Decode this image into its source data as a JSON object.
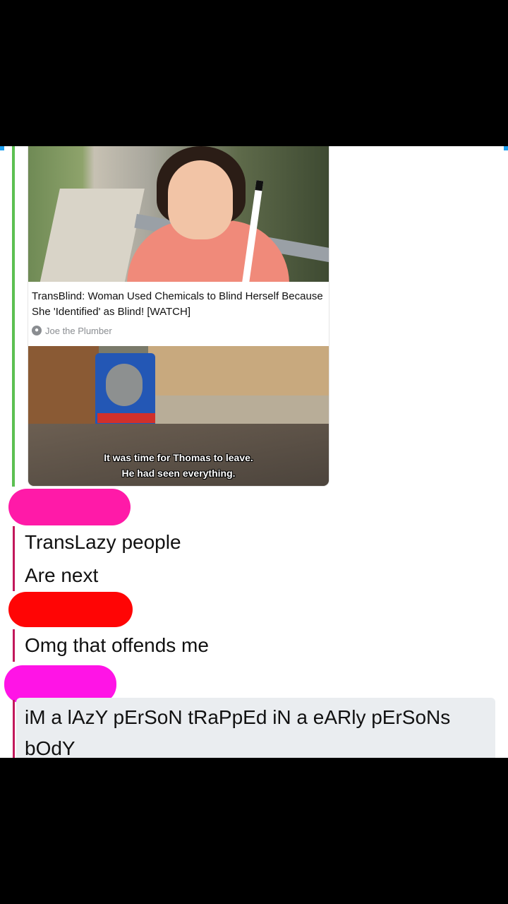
{
  "article": {
    "headline": "TransBlind: Woman Used Chemicals to Blind Herself Because She 'Identified' as Blind! [WATCH]",
    "source": "Joe the Plumber"
  },
  "meme": {
    "caption_line1": "It was time for Thomas to leave.",
    "caption_line2": "He had seen everything."
  },
  "messages": [
    {
      "text": "TransLazy people"
    },
    {
      "text": "Are next"
    },
    {
      "text": "Omg that offends me"
    },
    {
      "text": "iM a lAzY pErSoN tRaPpEd iN a eARly pErSoNs bOdY"
    }
  ],
  "colors": {
    "thread_green": "#5cc052",
    "reply_bar": "#c2185b",
    "redaction_1": "#ff1aa8",
    "redaction_2": "#ff0505",
    "redaction_3": "#ff14e6"
  }
}
